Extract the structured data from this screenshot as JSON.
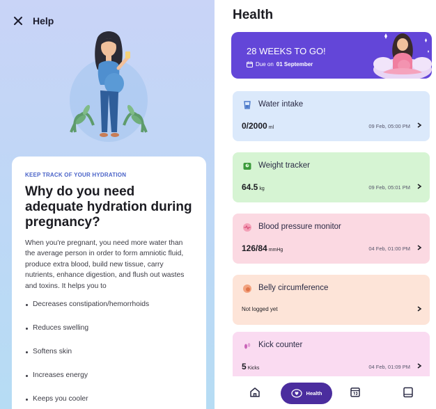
{
  "help_screen": {
    "header": {
      "title": "Help"
    },
    "article": {
      "kicker": "KEEP TRACK OF YOUR HYDRATION",
      "title": "Why do you need adequate hydration during pregnancy?",
      "body": "When you're pregnant, you need more water than the average person in order to form amniotic fluid, produce extra blood, build new tissue, carry nutrients, enhance digestion, and flush out wastes and toxins. It helps you to",
      "bullets": [
        "Decreases constipation/hemorrhoids",
        "Reduces swelling",
        "Softens skin",
        "Increases energy",
        "Keeps you cooler"
      ]
    }
  },
  "health_screen": {
    "title": "Health",
    "banner": {
      "headline": "28 WEEKS TO GO!",
      "due_prefix": "Due on",
      "due_date": "01 September",
      "color": "#6346d8"
    },
    "trackers": [
      {
        "name": "Water intake",
        "icon": "water-icon",
        "value": "0/2000",
        "unit": "ml",
        "date": "09 Feb, 05:00 PM",
        "bg": "#dbe9fb",
        "accent": "#4a78c9"
      },
      {
        "name": "Weight tracker",
        "icon": "scale-icon",
        "value": "64.5",
        "unit": "kg",
        "date": "09 Feb, 05:01 PM",
        "bg": "#d6f4d3",
        "accent": "#3c9a3c"
      },
      {
        "name": "Blood pressure monitor",
        "icon": "heart-pulse-icon",
        "value": "126/84",
        "unit": "mmHg",
        "date": "04 Feb, 01:00 PM",
        "bg": "#fbd9e2",
        "accent": "#d8507a"
      },
      {
        "name": "Belly circumference",
        "icon": "belly-icon",
        "status": "Not logged yet",
        "bg": "#fde4d8",
        "accent": "#e0744a"
      },
      {
        "name": "Kick counter",
        "icon": "footprint-icon",
        "value": "5",
        "unit": "Kicks",
        "date": "04 Feb, 01:09 PM",
        "bg": "#fadbf1",
        "accent": "#c963b8"
      }
    ],
    "bottom_nav": {
      "items": [
        {
          "icon": "home-icon"
        },
        {
          "icon": "heart-chat-icon",
          "label": "Health",
          "active": true
        },
        {
          "icon": "calendar-icon"
        },
        {
          "icon": "journal-icon"
        }
      ]
    }
  }
}
